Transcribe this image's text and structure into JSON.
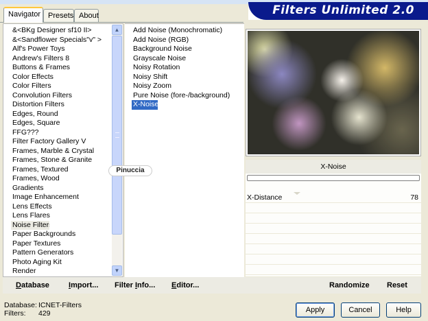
{
  "window": {
    "banner_title": "Filters Unlimited 2.0"
  },
  "tabs": [
    {
      "label": "Navigator",
      "active": true
    },
    {
      "label": "Presets",
      "active": false
    },
    {
      "label": "About",
      "active": false
    }
  ],
  "categories": {
    "items": [
      "&<BKg Designer sf10 II>",
      "&<Sandflower Specials\"v\" >",
      "Alf's Power Toys",
      "Andrew's Filters 8",
      "Buttons & Frames",
      "Color Effects",
      "Color Filters",
      "Convolution Filters",
      "Distortion Filters",
      "Edges, Round",
      "Edges, Square",
      "FFG???",
      "Filter Factory Gallery V",
      "Frames, Marble & Crystal",
      "Frames, Stone & Granite",
      "Frames, Textured",
      "Frames, Wood",
      "Gradients",
      "Image Enhancement",
      "Lens Effects",
      "Lens Flares",
      "Noise Filters",
      "Paper Backgrounds",
      "Paper Textures",
      "Pattern Generators",
      "Photo Aging Kit",
      "Render"
    ],
    "selected": "Noise Filters"
  },
  "filters": {
    "items": [
      "Add Noise (Monochromatic)",
      "Add Noise (RGB)",
      "Background Noise",
      "Grayscale Noise",
      "Noisy Rotation",
      "Noisy Shift",
      "Noisy Zoom",
      "Pure Noise (fore-/background)",
      "X-Noise"
    ],
    "selected": "X-Noise"
  },
  "params": {
    "filter_name": "X-Noise",
    "x_distance_label": "X-Distance",
    "x_distance_value": "78"
  },
  "watermark": "Pinuccia",
  "toolbar": {
    "database_u": "D",
    "database_rest": "atabase",
    "import_u": "I",
    "import_rest": "mport...",
    "filterinfo_pre": "Filter ",
    "filterinfo_u": "I",
    "filterinfo_rest": "nfo...",
    "editor_u": "E",
    "editor_rest": "ditor...",
    "randomize": "Randomize",
    "reset": "Reset"
  },
  "footer": {
    "database_key": "Database:",
    "database_value": "ICNET-Filters",
    "filters_key": "Filters:",
    "filters_value": "429"
  },
  "buttons": {
    "apply": "Apply",
    "cancel": "Cancel",
    "help": "Help"
  }
}
